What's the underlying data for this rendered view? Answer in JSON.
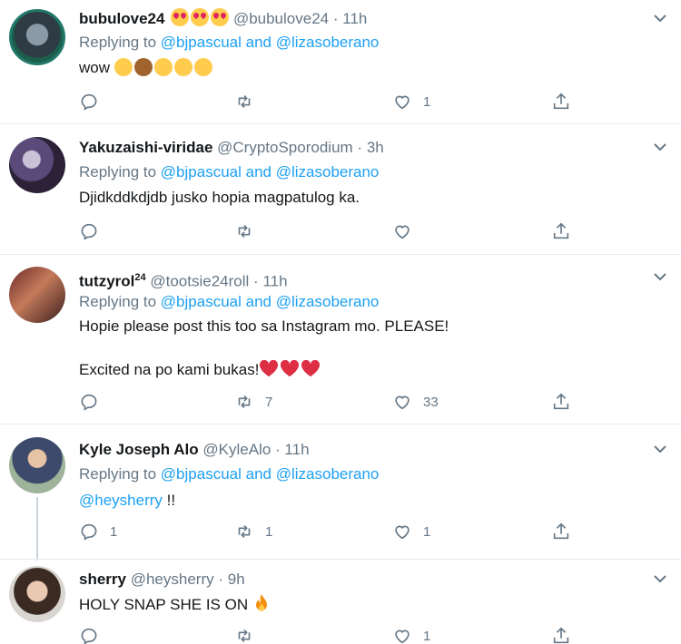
{
  "tweets": [
    {
      "name": "bubulove24",
      "handle": "@bubulove24",
      "time": "11h",
      "replying_prefix": "Replying to",
      "mention1": "@bjpascual",
      "and": "and",
      "mention2": "@lizasoberano",
      "text": "wow",
      "emojis": [
        "astonished",
        "see-no-evil-monkey",
        "hugging",
        "heart-eyes",
        "smiling-blush"
      ],
      "replies": "",
      "retweets": "",
      "likes": "1"
    },
    {
      "name": "Yakuzaishi-viridae",
      "handle": "@CryptoSporodium",
      "time": "3h",
      "replying_prefix": "Replying to",
      "mention1": "@bjpascual",
      "and": "and",
      "mention2": "@lizasoberano",
      "text": "Djidkddkdjdb jusko hopia magpatulog ka.",
      "replies": "",
      "retweets": "",
      "likes": ""
    },
    {
      "name": "tutzyrol",
      "name_sup": "24",
      "handle": "@tootsie24roll",
      "time": "11h",
      "replying_prefix": "Replying to",
      "mention1": "@bjpascual",
      "and": "and",
      "mention2": "@lizasoberano",
      "text_line1": "Hopie please post this too sa Instagram mo. PLEASE!",
      "text_line2": "Excited na po kami bukas!",
      "emojis": [
        "red-heart",
        "red-heart",
        "red-heart"
      ],
      "replies": "",
      "retweets": "7",
      "likes": "33"
    },
    {
      "name": "Kyle Joseph Alo",
      "handle": "@KyleAlo",
      "time": "11h",
      "replying_prefix": "Replying to",
      "mention1": "@bjpascual",
      "and": "and",
      "mention2": "@lizasoberano",
      "text_mention": "@heysherry",
      "text_suffix": " !!",
      "replies": "1",
      "retweets": "1",
      "likes": "1"
    },
    {
      "name": "sherry",
      "handle": "@heysherry",
      "time": "9h",
      "text": "HOLY SNAP SHE IS ON",
      "emojis": [
        "fire"
      ],
      "replies": "",
      "retweets": "",
      "likes": "1"
    }
  ],
  "separator": "·",
  "colors": {
    "link": "#1da1f2",
    "muted": "#657786",
    "text": "#14171a",
    "divider": "#e6ecf0",
    "heart": "#dd2e44"
  }
}
